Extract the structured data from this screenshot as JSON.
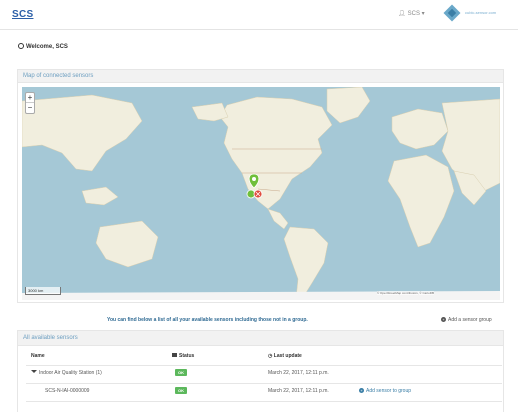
{
  "header": {
    "logo": "SCS",
    "user_label": "SCS ▾",
    "brand_text": "cubic-sensor.com"
  },
  "welcome": "Welcome, SCS",
  "map_panel": {
    "title": "Map of connected sensors",
    "zoom_in": "+",
    "zoom_out": "−",
    "scale_label": "3000 km",
    "attribution": "© OpenStreetMap contributors, © CartoDB"
  },
  "info_line": "You can find below a list of all your available sensors including those not in a group.",
  "add_group_label": "Add a sensor group",
  "sensors_panel": {
    "title": "All available sensors",
    "columns": {
      "name": "Name",
      "status": "Status",
      "last_update": "Last update"
    },
    "rows": [
      {
        "name": "Indoor Air Quality Station (1)",
        "status": "OK",
        "last_update": "March 22, 2017, 12:11 p.m.",
        "action": ""
      },
      {
        "name": "SCS-N-IAI-0000009",
        "status": "OK",
        "last_update": "March 22, 2017, 12:11 p.m.",
        "action": "Add sensor to group"
      }
    ]
  },
  "colors": {
    "ocean": "#a5c8d6",
    "land": "#f1eede",
    "ok_badge": "#5cb85c",
    "marker_ok": "#6fbf3b",
    "marker_error": "#e04b3c"
  },
  "map_markers": [
    {
      "type": "cluster-ok",
      "icon": "map-pin-icon"
    },
    {
      "type": "error",
      "icon": "map-pin-icon"
    }
  ]
}
